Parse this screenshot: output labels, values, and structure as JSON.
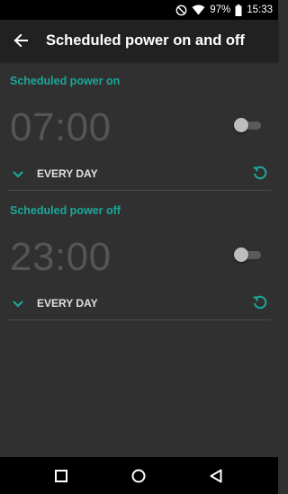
{
  "status_bar": {
    "battery_percent": "97%",
    "time": "15:33",
    "icons": [
      "do-not-disturb-icon",
      "wifi-icon",
      "battery-icon"
    ]
  },
  "app_bar": {
    "title": "Scheduled power on and off",
    "back_icon": "arrow-back-icon"
  },
  "power_on": {
    "header": "Scheduled power on",
    "time": "07:00",
    "enabled": false,
    "repeat": "EVERY DAY"
  },
  "power_off": {
    "header": "Scheduled power off",
    "time": "23:00",
    "enabled": false,
    "repeat": "EVERY DAY"
  },
  "nav_bar": {
    "icons": [
      "recents-icon",
      "home-icon",
      "back-icon"
    ]
  },
  "colors": {
    "accent": "#1aa89a",
    "background": "#303030",
    "app_bar": "#212121",
    "time_text": "#555555"
  }
}
